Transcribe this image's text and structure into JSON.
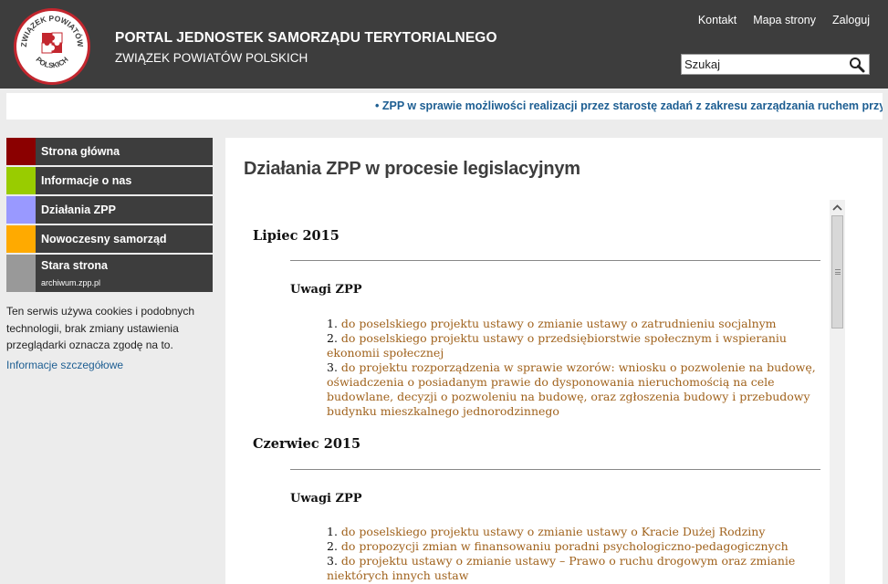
{
  "header": {
    "title": "PORTAL JEDNOSTEK SAMORZĄDU TERYTORIALNEGO",
    "subtitle": "ZWIĄZEK POWIATÓW POLSKICH",
    "logo_text_top": "ZWIĄZEK POWIATÓW",
    "logo_text_bottom": "POLSKICH",
    "nav": [
      "Kontakt",
      "Mapa strony",
      "Zaloguj"
    ],
    "search_placeholder": "Szukaj"
  },
  "ticker": {
    "text": "• ZPP w sprawie możliwości realizacji przez starostę zadań z zakresu zarządzania ruchem przy pomocy"
  },
  "sidebar": {
    "items": [
      {
        "label": "Strona główna",
        "color": "#8b0000"
      },
      {
        "label": "Informacje o nas",
        "color": "#99cc00"
      },
      {
        "label": "Działania ZPP",
        "color": "#9999ff"
      },
      {
        "label": "Nowoczesny samorząd",
        "color": "#ffaa00"
      },
      {
        "label": "Stara strona",
        "sublabel": "archiwum.zpp.pl",
        "color": "#999999"
      }
    ],
    "cookie_text": "Ten serwis używa cookies i podobnych technologii, brak zmiany ustawienia przeglądarki oznacza zgodę na to.",
    "cookie_link": "Informacje szczegółowe"
  },
  "main": {
    "title": "Działania ZPP w procesie legislacyjnym",
    "sections": [
      {
        "month": "Lipiec 2015",
        "heading": "Uwagi ZPP",
        "items": [
          {
            "num": "1.",
            "text": "do poselskiego projektu ustawy o zmianie ustawy o zatrudnieniu socjalnym"
          },
          {
            "num": "2.",
            "text": "do poselskiego projektu ustawy o przedsiębiorstwie społecznym i wspieraniu ekonomii społecznej"
          },
          {
            "num": "3.",
            "text": "do projektu rozporządzenia w sprawie wzorów: wniosku o pozwolenie na budowę, oświadczenia o posiadanym prawie do dysponowania nieruchomością na cele budowlane, decyzji o pozwoleniu na budowę, oraz zgłoszenia budowy i przebudowy budynku mieszkalnego jednorodzinnego"
          }
        ]
      },
      {
        "month": "Czerwiec 2015",
        "heading": "Uwagi ZPP",
        "items": [
          {
            "num": "1.",
            "text": "do poselskiego projektu ustawy o zmianie ustawy o Kracie Dużej Rodziny"
          },
          {
            "num": "2.",
            "text": "do propozycji zmian w finansowaniu poradni psychologiczno-pedagogicznych"
          },
          {
            "num": "3.",
            "text": "do projektu ustawy o zmianie ustawy – Prawo o ruchu drogowym oraz zmianie niektórych innych ustaw"
          }
        ]
      }
    ]
  },
  "icons": {
    "search": "search-icon",
    "scroll_up": "chevron-up-icon"
  }
}
